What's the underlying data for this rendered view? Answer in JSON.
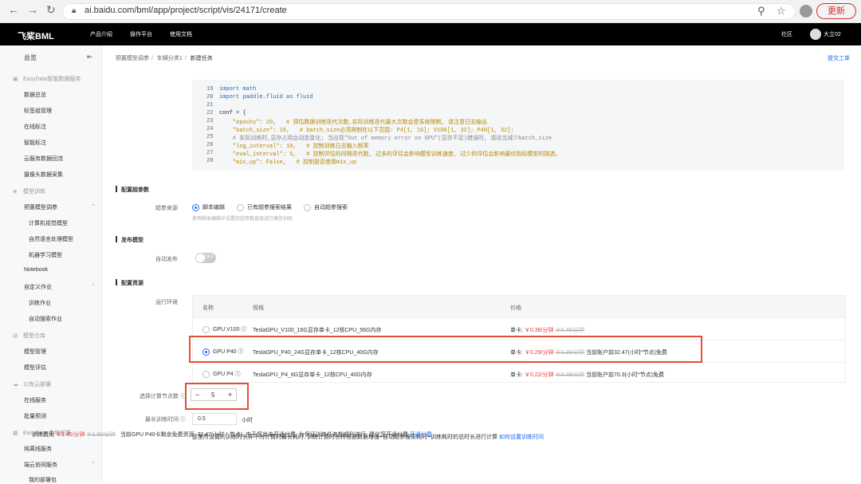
{
  "browser": {
    "url": "ai.baidu.com/bml/app/project/script/vis/24171/create",
    "update_label": "更新"
  },
  "topnav": {
    "logo": "飞桨BML",
    "items": [
      "产品介绍",
      "操作平台",
      "使用文档"
    ],
    "community": "社区",
    "user": "大立02"
  },
  "sidebar": {
    "overview": "总览",
    "items": [
      {
        "label": "EasyData智能数据服务",
        "group": true
      },
      {
        "label": "数据总览"
      },
      {
        "label": "标签组管理"
      },
      {
        "label": "在线标注"
      },
      {
        "label": "智能标注"
      },
      {
        "label": "云服务数据回流"
      },
      {
        "label": "摄像头数据采集"
      },
      {
        "label": "模型训练",
        "group": true
      },
      {
        "label": "预置模型调参"
      },
      {
        "label": "计算机视觉模型"
      },
      {
        "label": "自然语言处理模型"
      },
      {
        "label": "机器学习模型"
      },
      {
        "label": "Notebook"
      },
      {
        "label": "自定义作业"
      },
      {
        "label": "训练作业"
      },
      {
        "label": "自动搜索作业"
      },
      {
        "label": "模型仓库",
        "group": true
      },
      {
        "label": "模型管理"
      },
      {
        "label": "模型评估"
      },
      {
        "label": "公有云部署",
        "group": true
      },
      {
        "label": "在线服务"
      },
      {
        "label": "批量预测"
      },
      {
        "label": "EasyEdge本地部署",
        "group": true
      },
      {
        "label": "纯离线服务"
      },
      {
        "label": "端云协同服务"
      },
      {
        "label": "我的部署包"
      }
    ]
  },
  "breadcrumb": [
    "预置模型调参",
    "车辆分类1",
    "新建任务"
  ],
  "report_label": "提交工单",
  "code": [
    {
      "n": "19",
      "t": "import math"
    },
    {
      "n": "20",
      "t": "import paddle.fluid as fluid"
    },
    {
      "n": "21",
      "t": ""
    },
    {
      "n": "22",
      "t": "conf = {"
    },
    {
      "n": "23",
      "t": "    \"epochs\": 20,   # 预估数据训练迭代次数,实际训练迭代最大次数会受系统限制, 请注意日志输出"
    },
    {
      "n": "24",
      "t": "    \"batch_size\": 16,   # batch_size必须限制在以下范围: P4[1, 16]; V100[1, 32]; P40[1, 32];"
    },
    {
      "n": "25",
      "t": "    # 实际训练时,显存占用会动态变化; 当出现\"Out of memory error on GPU\"(显存不足)错误时, 请适当减少batch_size"
    },
    {
      "n": "26",
      "t": "    \"log_interval\": 10,   # 控制训练日志输入频率"
    },
    {
      "n": "27",
      "t": "    \"eval_interval\": 5,   # 控制评估的间隔迭代数, 过多的评估会影响模型训练速度, 过少的评估会影响最优指标模型的挑选。"
    },
    {
      "n": "28",
      "t": "    \"mix_up\": False,   # 控制是否使用mix_up"
    }
  ],
  "hyper": {
    "section": "配置超参数",
    "label": "超参来源",
    "options": [
      "脚本编辑",
      "已有超参搜索结果",
      "自动超参搜索"
    ],
    "hint": "使用脚本编辑中设置的超参数直接进行模型训练"
  },
  "publish": {
    "section": "发布模型",
    "label": "自动发布",
    "toggle": "OFF"
  },
  "resource": {
    "section": "配置资源",
    "env_label": "运行环境",
    "columns": [
      "名称",
      "规格",
      "价格"
    ],
    "rows": [
      {
        "name": "GPU V100",
        "spec": "TeslaGPU_V100_16G显存单卡_12核CPU_56G内存",
        "unit": "单卡:",
        "price": "￥0.36/分钟",
        "orig": "￥0.45/分钟",
        "note": "",
        "selected": false
      },
      {
        "name": "GPU P40",
        "spec": "TeslaGPU_P40_24G显存单卡_12核CPU_40G内存",
        "unit": "单卡:",
        "price": "￥0.29/分钟",
        "orig": "￥0.36/分钟",
        "note": "当前账户前32.47(小时*节点)免费",
        "selected": true
      },
      {
        "name": "GPU P4",
        "spec": "TeslaGPU_P4_8G显存单卡_12核CPU_40G内存",
        "unit": "单卡:",
        "price": "￥0.22/分钟",
        "orig": "￥0.28/分钟",
        "note": "当前账户前70.3(小时*节点)免费",
        "selected": false
      }
    ],
    "node_label": "选择计算节点数",
    "node_count": "5",
    "time_label": "最长训练时间",
    "time_value": "0.5",
    "time_unit": "小时",
    "time_tip": "这里所设置的训练时长并不为计费的最长耗时, 训练计费时长将根据数据增强+自动超参搜索耗时+训练耗时的总时长进行计算",
    "time_link": "如何设置训练时间"
  },
  "footer": {
    "fee_label": "训练费用",
    "fee": "￥1.45/分钟",
    "fee_orig": "￥1.80/分钟",
    "note": "当前GPU P40卡剩余免费资源: 32.47(小时 * 节点), 由于您尚未开通付费, 为保证训练任务能顺利进行, 建议您开通付费",
    "link": "开通付费"
  },
  "accent": "#2468f2",
  "highlight": "#e24f34"
}
